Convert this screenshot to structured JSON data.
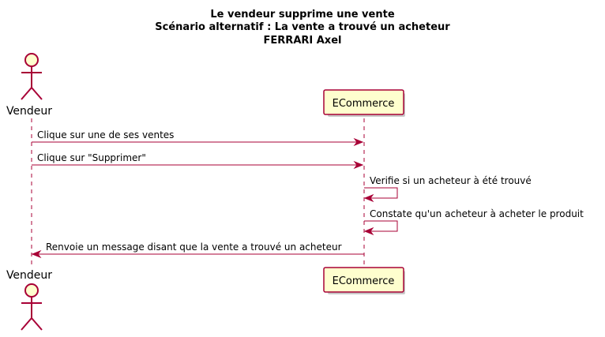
{
  "title": {
    "line1": "Le vendeur supprime une vente",
    "line2": "Scénario alternatif : La vente a trouvé un acheteur",
    "line3": "FERRARI Axel"
  },
  "participants": {
    "actor": "Vendeur",
    "system": "ECommerce"
  },
  "messages": [
    {
      "text": "Clique sur une de ses ventes",
      "from": "Vendeur",
      "to": "ECommerce"
    },
    {
      "text": "Clique sur \"Supprimer\"",
      "from": "Vendeur",
      "to": "ECommerce"
    },
    {
      "text": "Verifie si un acheteur à été trouvé",
      "from": "ECommerce",
      "to": "ECommerce"
    },
    {
      "text": "Constate qu'un acheteur à acheter le produit",
      "from": "ECommerce",
      "to": "ECommerce"
    },
    {
      "text": "Renvoie un message disant que la vente a trouvé un acheteur",
      "from": "ECommerce",
      "to": "Vendeur"
    }
  ],
  "colors": {
    "line": "#A80036",
    "box_fill": "#FEFECE"
  }
}
